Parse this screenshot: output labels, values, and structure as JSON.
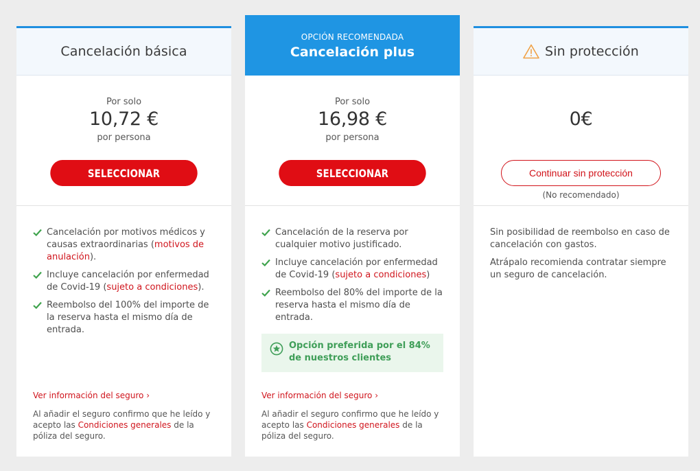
{
  "options": {
    "basic": {
      "title": "Cancelación básica",
      "price_prefix": "Por solo",
      "price": "10,72 €",
      "price_suffix": "por persona",
      "button_label": "SELECCIONAR",
      "features": [
        {
          "text": "Cancelación por motivos médicos y causas extraordinarias (",
          "link": "motivos de anulación",
          "tail": ")."
        },
        {
          "text": "Incluye cancelación por enfermedad de Covid-19 (",
          "link": "sujeto a condiciones",
          "tail": ")."
        },
        {
          "text": "Reembolso del 100% del importe de la reserva hasta el mismo día de entrada.",
          "link": "",
          "tail": ""
        }
      ],
      "info_link": "Ver información del seguro ›",
      "legal_pre": "Al añadir el seguro confirmo que he leído y acepto las ",
      "legal_link": "Condiciones generales",
      "legal_post": " de la póliza del seguro."
    },
    "plus": {
      "badge": "OPCIÓN RECOMENDADA",
      "title": "Cancelación plus",
      "price_prefix": "Por solo",
      "price": "16,98 €",
      "price_suffix": "por persona",
      "button_label": "SELECCIONAR",
      "features": [
        {
          "text": "Cancelación de la reserva por cualquier motivo justificado.",
          "link": "",
          "tail": ""
        },
        {
          "text": "Incluye cancelación por enfermedad de Covid-19 (",
          "link": "sujeto a condiciones",
          "tail": ")"
        },
        {
          "text": "Reembolso del 80% del importe de la reserva hasta el mismo día de entrada.",
          "link": "",
          "tail": ""
        }
      ],
      "preferred_note": "Opción preferida por el 84% de nuestros clientes",
      "info_link": "Ver información del seguro ›",
      "legal_pre": "Al añadir el seguro confirmo que he leído y acepto las ",
      "legal_link": "Condiciones generales",
      "legal_post": " de la póliza del seguro."
    },
    "none": {
      "title": "Sin protección",
      "price": "0€",
      "button_label": "Continuar sin protección",
      "button_note": "(No recomendado)",
      "paragraphs": [
        "Sin posibilidad de reembolso en caso de cancelación con gastos.",
        "Atrápalo recomienda contratar siempre un seguro de cancelación."
      ]
    }
  },
  "icons": {
    "check": "check-icon",
    "warning": "warning-icon",
    "star": "star-icon"
  },
  "colors": {
    "accent_blue": "#1f95e3",
    "action_red": "#e00d14",
    "link_red": "#d0151d",
    "check_green": "#3fa34d",
    "preferred_bg": "#eaf6ec"
  }
}
